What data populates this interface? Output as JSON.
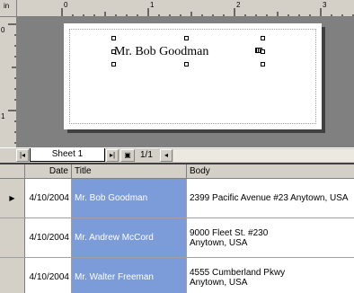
{
  "designer": {
    "ruler_unit": "in",
    "ruler_h_numbers": [
      "0",
      "1",
      "2",
      "3"
    ],
    "ruler_v_numbers": [
      "0",
      "1"
    ],
    "label_text": "Mr. Bob Goodman"
  },
  "tabbar": {
    "first_label": "|◂",
    "sheet_name": "Sheet 1",
    "next_label": "▸|",
    "add_label": "▣",
    "page_count": "1/1",
    "scroll_left_label": "◂"
  },
  "grid": {
    "columns": [
      "",
      "Date",
      "Title",
      "Body"
    ],
    "current_row_marker": "▶",
    "rows": [
      {
        "date": "4/10/2004",
        "title": "Mr. Bob Goodman",
        "body_line1": "2399 Pacific Avenue #23 Anytown, USA",
        "body_line2": ""
      },
      {
        "date": "4/10/2004",
        "title": "Mr. Andrew McCord",
        "body_line1": "9000 Fleet St. #230",
        "body_line2": "Anytown, USA"
      },
      {
        "date": "4/10/2004",
        "title": "Mr. Walter Freeman",
        "body_line1": "4555 Cumberland Pkwy",
        "body_line2": "Anytown, USA"
      }
    ]
  },
  "colors": {
    "workspace": "#808080",
    "chrome": "#d4d0c8",
    "title_column": "#7b9bd9"
  }
}
